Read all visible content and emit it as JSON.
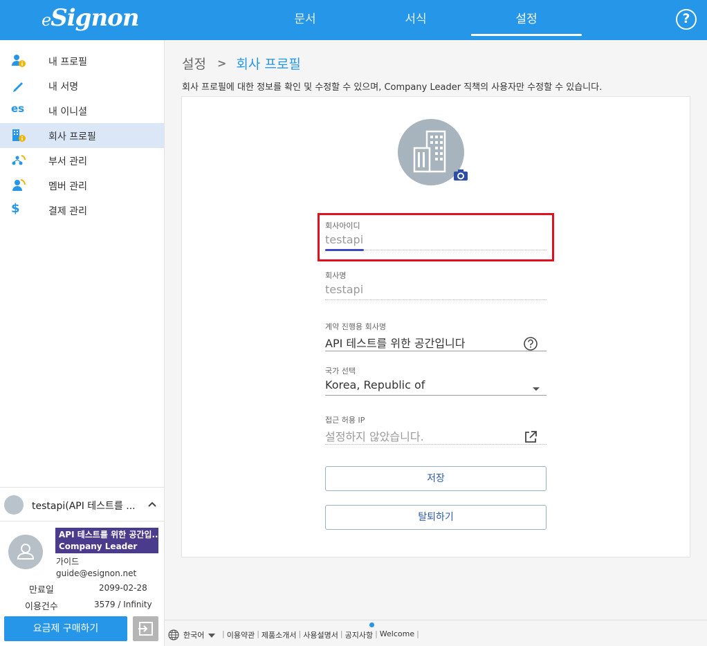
{
  "header": {
    "logo_prefix": "e",
    "logo_main": "Signon",
    "tabs": [
      {
        "label": "문서"
      },
      {
        "label": "서식"
      },
      {
        "label": "설정"
      }
    ],
    "active_tab": "설정",
    "help_label": "?"
  },
  "sidebar": {
    "items": [
      {
        "label": "내 프로필",
        "icon": "user-info-icon"
      },
      {
        "label": "내 서명",
        "icon": "pen-icon"
      },
      {
        "label": "내 이니셜",
        "icon": "initials-icon",
        "icon_text": "es"
      },
      {
        "label": "회사 프로필",
        "icon": "building-info-icon"
      },
      {
        "label": "부서 관리",
        "icon": "department-icon"
      },
      {
        "label": "멤버 관리",
        "icon": "members-icon"
      },
      {
        "label": "결제 관리",
        "icon": "payment-icon",
        "icon_text": "$"
      }
    ],
    "active_item": "회사 프로필",
    "account": {
      "name": "testapi(API 테스트를 ..."
    },
    "user": {
      "company": "API 테스트를 위한 공간입...",
      "role": "Company Leader",
      "name": "가이드",
      "email": "guide@esignon.net"
    },
    "stats": {
      "expiry_label": "만료일",
      "expiry_value": "2099-02-28",
      "usage_label": "이용건수",
      "usage_value": "3579 / Infinity"
    },
    "buy_label": "요금제 구매하기"
  },
  "main": {
    "breadcrumb": [
      "설정",
      "회사 프로필"
    ],
    "description": "회사 프로필에 대한 정보를 확인 및 수정할 수 있으며, Company Leader 직책의 사용자만 수정할 수 있습니다.",
    "fields": {
      "company_id": {
        "label": "회사아이디",
        "value": "testapi"
      },
      "company_name": {
        "label": "회사명",
        "value": "testapi"
      },
      "contract_name": {
        "label": "계약 진행용 회사명",
        "value": "API 테스트를 위한 공간입니다"
      },
      "country": {
        "label": "국가 선택",
        "value": "Korea, Republic of"
      },
      "ip": {
        "label": "접근 허용 IP",
        "value": "설정하지 않았습니다."
      }
    },
    "save_label": "저장",
    "withdraw_label": "탈퇴하기"
  },
  "footer": {
    "language": "한국어",
    "links": [
      "이용약관",
      "제품소개서",
      "사용설명서",
      "공지사항",
      "Welcome"
    ]
  },
  "colors": {
    "primary": "#2596e8",
    "highlight": "#e0101e",
    "badge": "#4a3b8c"
  }
}
